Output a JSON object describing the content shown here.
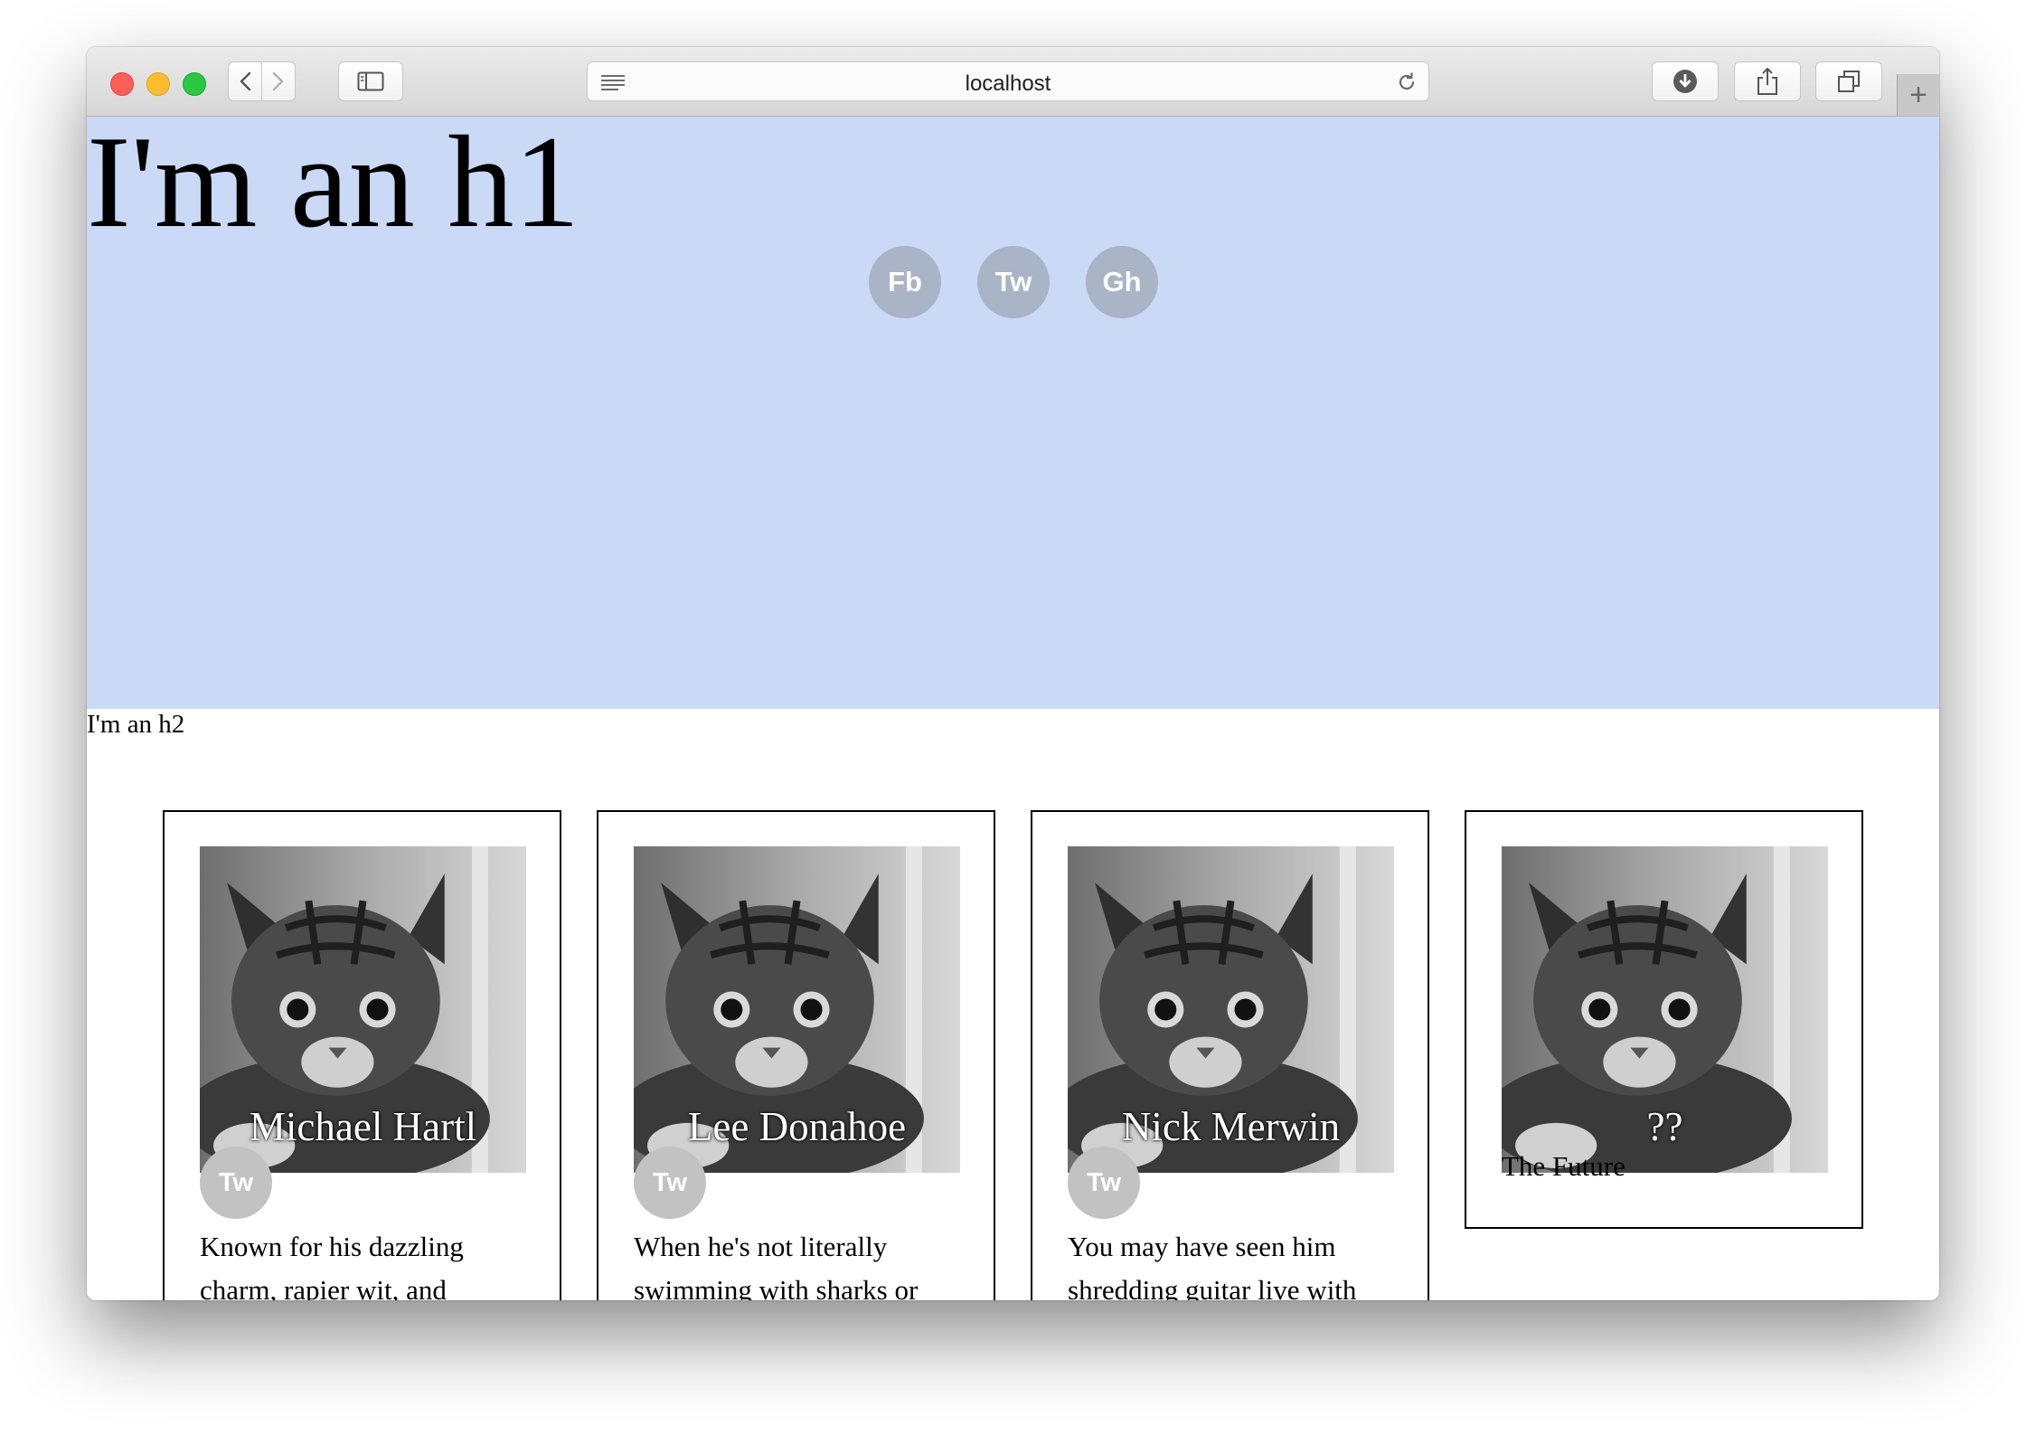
{
  "browser": {
    "url": "localhost",
    "new_tab_label": "+"
  },
  "page": {
    "h1": "I'm an h1",
    "h2": "I'm an h2",
    "social_links": [
      "Fb",
      "Tw",
      "Gh"
    ]
  },
  "cards": [
    {
      "name": "Michael Hartl",
      "twitter_label": "Tw",
      "bio": "Known for his dazzling charm, rapier wit, and"
    },
    {
      "name": "Lee Donahoe",
      "twitter_label": "Tw",
      "bio": "When he's not literally swimming with sharks or"
    },
    {
      "name": "Nick Merwin",
      "twitter_label": "Tw",
      "bio": "You may have seen him shredding guitar live with"
    },
    {
      "name": "??",
      "subtitle": "The Future"
    }
  ],
  "colors": {
    "hero_background": "#c9d9f6",
    "social_button": "#a9b4c6",
    "card_twitter_button": "#c2c2c2"
  }
}
